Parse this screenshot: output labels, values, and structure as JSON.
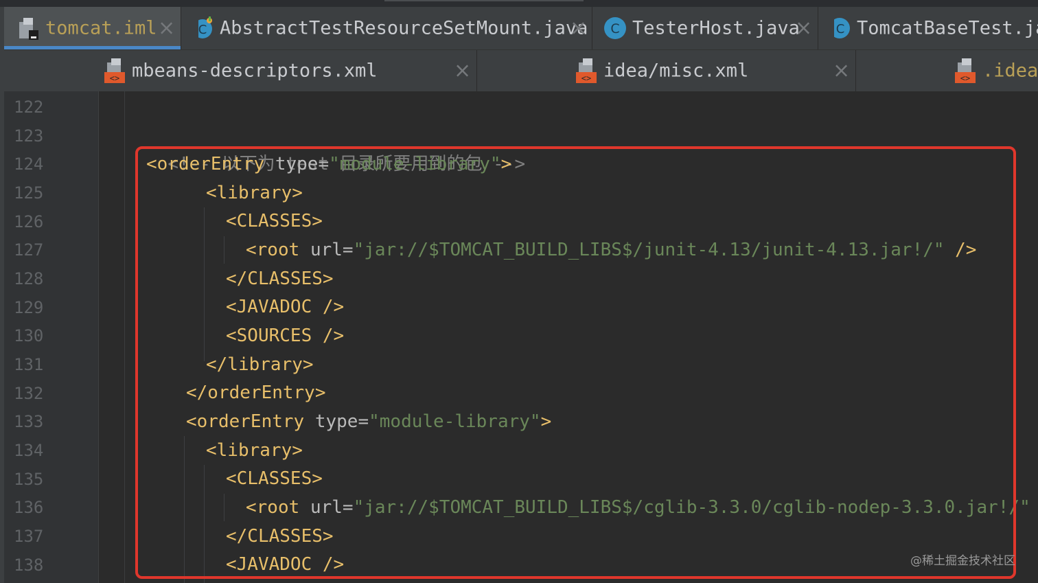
{
  "tabs_row1": [
    {
      "label": "tomcat.iml",
      "icon": "iml-file-icon",
      "active": true
    },
    {
      "label": "AbstractTestResourceSetMount.java",
      "icon": "abstract-class-icon"
    },
    {
      "label": "TesterHost.java",
      "icon": "class-icon"
    },
    {
      "label": "TomcatBaseTest.java",
      "icon": "abstract-class-icon"
    }
  ],
  "tabs_row2": [
    {
      "label": "mbeans-descriptors.xml",
      "icon": "xml-file-icon"
    },
    {
      "label": "idea/misc.xml",
      "icon": "xml-file-icon"
    },
    {
      "label": ".idea/",
      "icon": "xml-file-icon"
    }
  ],
  "line_numbers": [
    "122",
    "123",
    "124",
    "125",
    "126",
    "127",
    "128",
    "129",
    "130",
    "131",
    "132",
    "133",
    "134",
    "135",
    "136",
    "137",
    "138"
  ],
  "code": {
    "comment": "<!-- 以下为 test 目录所要用到的包 -->",
    "orderEntry_open": "<orderEntry",
    "type_attr": "type",
    "eq": "=",
    "module_library": "\"module-library\"",
    "gt": ">",
    "library_open": "<library>",
    "classes_open": "<CLASSES>",
    "root_open": "<root",
    "url_attr": "url",
    "url_junit": "\"jar://$TOMCAT_BUILD_LIBS$/junit-4.13/junit-4.13.jar!/\"",
    "url_cglib": "\"jar://$TOMCAT_BUILD_LIBS$/cglib-3.3.0/cglib-nodep-3.3.0.jar!/\"",
    "self_close": " />",
    "classes_close": "</CLASSES>",
    "javadoc": "<JAVADOC />",
    "sources": "<SOURCES />",
    "library_close": "</library>",
    "orderEntry_close": "</orderEntry>"
  },
  "watermark": "@稀土掘金技术社区",
  "colors": {
    "background": "#2b2b2b",
    "tag": "#e8bf6a",
    "attribute": "#bababa",
    "value": "#6a8759",
    "comment": "#808080",
    "highlight_border": "#e0372c",
    "active_tab_underline": "#4a88c7"
  }
}
